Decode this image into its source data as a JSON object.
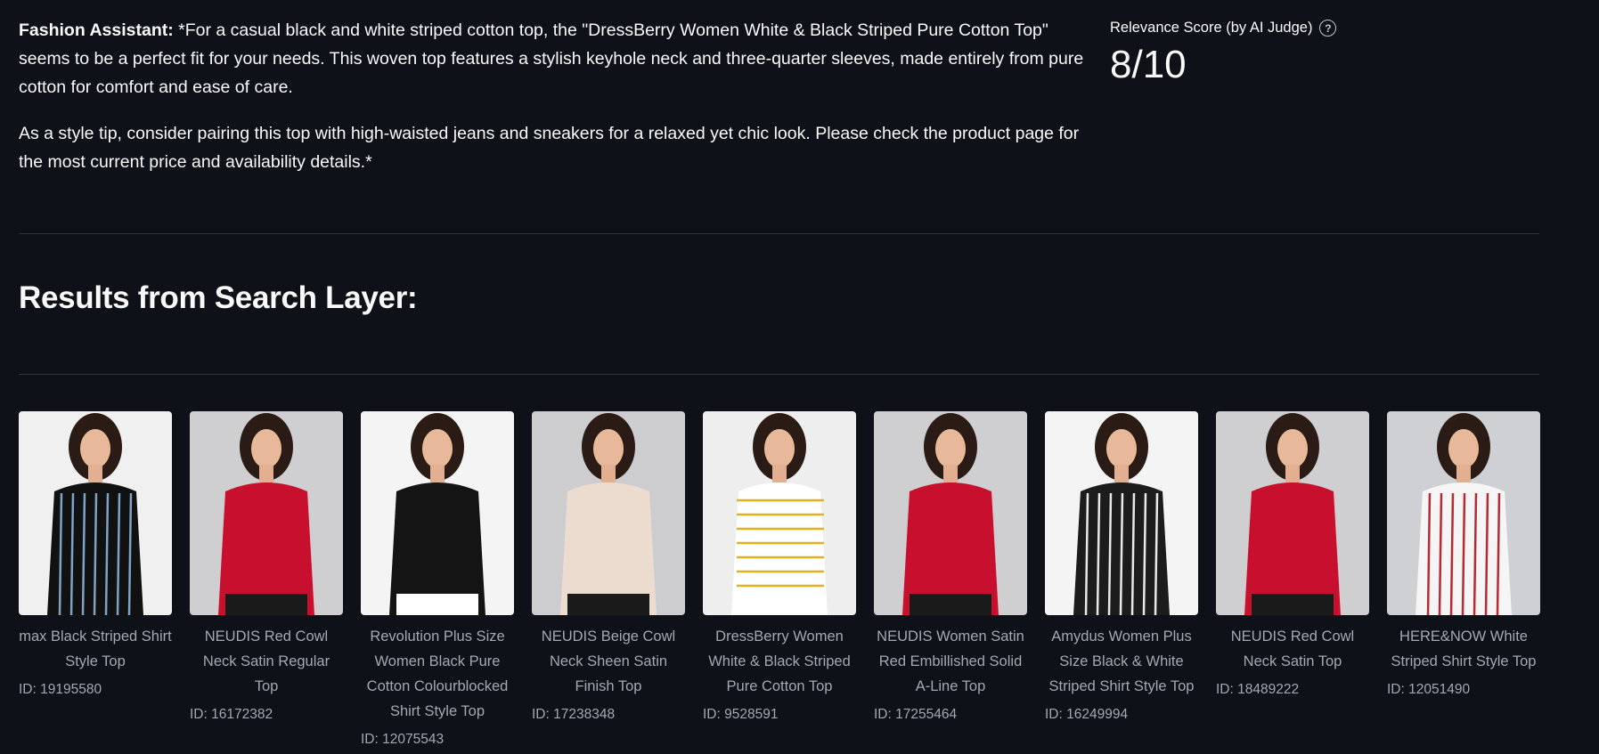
{
  "assistant": {
    "prefix": "Fashion Assistant:",
    "paragraph1": " *For a casual black and white striped cotton top, the \"DressBerry Women White & Black Striped Pure Cotton Top\" seems to be a perfect fit for your needs. This woven top features a stylish keyhole neck and three-quarter sleeves, made entirely from pure cotton for comfort and ease of care.",
    "paragraph2": "As a style tip, consider pairing this top with high-waisted jeans and sneakers for a relaxed yet chic look. Please check the product page for the most current price and availability details.*"
  },
  "metric": {
    "label": "Relevance Score (by AI Judge)",
    "help_icon": "question-circle-icon",
    "value": "8/10"
  },
  "results": {
    "title": "Results from Search Layer:",
    "items": [
      {
        "name": "max Black Striped Shirt Style Top",
        "id": "ID: 19195580",
        "bg": "#f0f0f0",
        "garment": "#111111",
        "accent": "#7fa3c7"
      },
      {
        "name": "NEUDIS Red Cowl Neck Satin Regular Top",
        "id": "ID: 16172382",
        "bg": "#cfcfd1",
        "garment": "#c8102e",
        "accent": "#1a1a1a"
      },
      {
        "name": "Revolution Plus Size Women Black Pure Cotton Colourblocked Shirt Style Top",
        "id": "ID: 12075543",
        "bg": "#f4f4f4",
        "garment": "#141414",
        "accent": "#ffffff"
      },
      {
        "name": "NEUDIS Beige Cowl Neck Sheen Satin Finish Top",
        "id": "ID: 17238348",
        "bg": "#cdcdcf",
        "garment": "#ecdcd0",
        "accent": "#1a1a1a"
      },
      {
        "name": "DressBerry Women White & Black Striped Pure Cotton Top",
        "id": "ID: 9528591",
        "bg": "#eeeeee",
        "garment": "#ffffff",
        "accent": "#e2b021"
      },
      {
        "name": "NEUDIS Women Satin Red Embillished Solid A-Line Top",
        "id": "ID: 17255464",
        "bg": "#cfcfd1",
        "garment": "#c8102e",
        "accent": "#1a1a1a"
      },
      {
        "name": "Amydus Women Plus Size Black & White Striped Shirt Style Top",
        "id": "ID: 16249994",
        "bg": "#f4f4f4",
        "garment": "#1c1c1c",
        "accent": "#e8e8e8"
      },
      {
        "name": "NEUDIS Red Cowl Neck Satin Top",
        "id": "ID: 18489222",
        "bg": "#cfcfd1",
        "garment": "#c8102e",
        "accent": "#1a1a1a"
      },
      {
        "name": "HERE&NOW White Striped Shirt Style Top",
        "id": "ID: 12051490",
        "bg": "#cfd0d4",
        "garment": "#f5f5f5",
        "accent": "#b52a35"
      }
    ]
  }
}
